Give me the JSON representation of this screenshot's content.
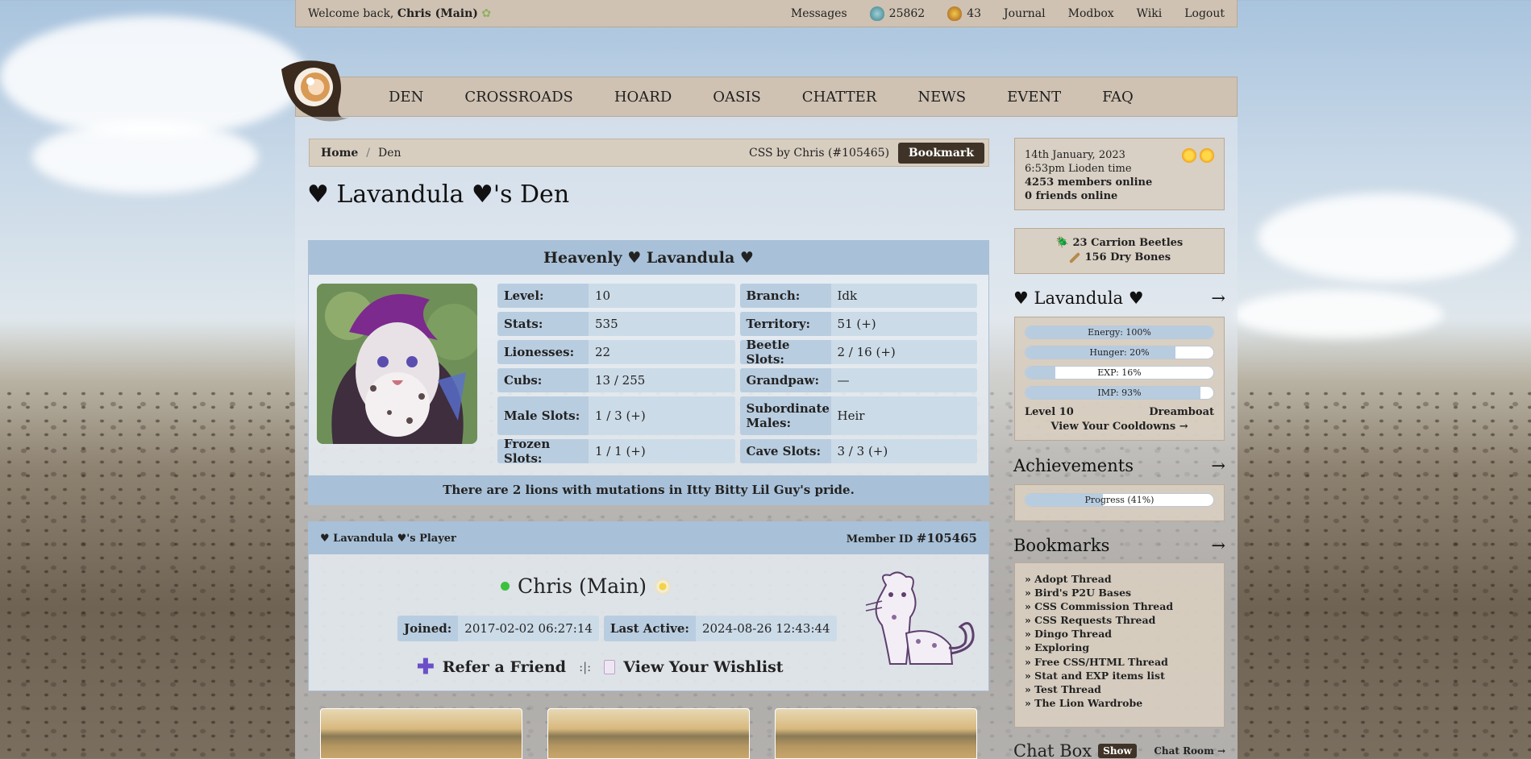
{
  "topbar": {
    "welcome_prefix": "Welcome back,",
    "username": "Chris (Main)",
    "messages": "Messages",
    "currency1": "25862",
    "currency2": "43",
    "journal": "Journal",
    "modbox": "Modbox",
    "wiki": "Wiki",
    "logout": "Logout"
  },
  "nav": [
    "DEN",
    "CROSSROADS",
    "HOARD",
    "OASIS",
    "CHATTER",
    "NEWS",
    "EVENT",
    "FAQ"
  ],
  "breadcrumb": {
    "home": "Home",
    "sep": "/",
    "current": "Den",
    "css_by": "CSS by Chris (#105465)",
    "bookmark": "Bookmark"
  },
  "page_title": "♥ Lavandula ♥'s Den",
  "lion": {
    "name": "Heavenly ♥ Lavandula ♥",
    "stats": [
      {
        "k1": "Level:",
        "v1": "10",
        "k2": "Branch:",
        "v2": "Idk"
      },
      {
        "k1": "Stats:",
        "v1": "535",
        "k2": "Territory:",
        "v2": "51 (+)"
      },
      {
        "k1": "Lionesses:",
        "v1": "22",
        "k2": "Beetle Slots:",
        "v2": "2 / 16 (+)"
      },
      {
        "k1": "Cubs:",
        "v1": "13 / 255",
        "k2": "Grandpaw:",
        "v2": "—"
      },
      {
        "k1": "Male Slots:",
        "v1": "1 / 3 (+)",
        "k2": "Subordinate Males:",
        "v2": "Heir"
      },
      {
        "k1": "Frozen Slots:",
        "v1": "1 / 1 (+)",
        "k2": "Cave Slots:",
        "v2": "3 / 3 (+)"
      }
    ],
    "mutation_text": "There are 2 lions with mutations in Itty Bitty Lil Guy's pride."
  },
  "player": {
    "header": "♥ Lavandula ♥'s Player",
    "member_id_label": "Member ID",
    "member_id": "#105465",
    "name": "Chris (Main)",
    "joined_label": "Joined:",
    "joined": "2017-02-02 06:27:14",
    "active_label": "Last Active:",
    "active": "2024-08-26 12:43:44",
    "refer": "Refer a Friend",
    "sep": ":|:",
    "wishlist": "View Your Wishlist"
  },
  "side": {
    "date": "14th January, 2023",
    "time": "6:53pm Lioden time",
    "members": "4253 members online",
    "friends": "0 friends online",
    "beetles": "23 Carrion Beetles",
    "bones": "156 Dry Bones",
    "lav_title": "♥ Lavandula ♥",
    "arrow": "→",
    "bars": [
      {
        "label": "Energy: 100%",
        "value": 100
      },
      {
        "label": "Hunger: 20%",
        "value": 80
      },
      {
        "label": "EXP: 16%",
        "value": 16
      },
      {
        "label": "IMP: 93%",
        "value": 93
      }
    ],
    "level": "Level 10",
    "title": "Dreamboat",
    "cooldowns": "View Your Cooldowns →",
    "ach_title": "Achievements",
    "ach_progress": "Progress (41%)",
    "ach_value": 41,
    "bm_title": "Bookmarks",
    "bookmarks": [
      "» Adopt Thread",
      "» Bird's P2U Bases",
      "» CSS Commission Thread",
      "» CSS Requests Thread",
      "» Dingo Thread",
      "» Exploring",
      "» Free CSS/HTML Thread",
      "» Stat and EXP items list",
      "» Test Thread",
      "» The Lion Wardrobe"
    ],
    "chat_title": "Chat Box",
    "show": "Show",
    "chat_room": "Chat Room →"
  }
}
